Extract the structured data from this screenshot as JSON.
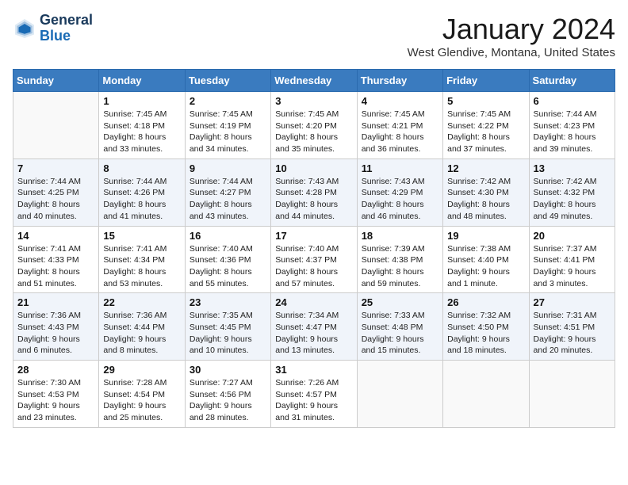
{
  "header": {
    "logo_line1": "General",
    "logo_line2": "Blue",
    "month_title": "January 2024",
    "location": "West Glendive, Montana, United States"
  },
  "days_of_week": [
    "Sunday",
    "Monday",
    "Tuesday",
    "Wednesday",
    "Thursday",
    "Friday",
    "Saturday"
  ],
  "weeks": [
    [
      {
        "day": "",
        "sunrise": "",
        "sunset": "",
        "daylight": ""
      },
      {
        "day": "1",
        "sunrise": "Sunrise: 7:45 AM",
        "sunset": "Sunset: 4:18 PM",
        "daylight": "Daylight: 8 hours and 33 minutes."
      },
      {
        "day": "2",
        "sunrise": "Sunrise: 7:45 AM",
        "sunset": "Sunset: 4:19 PM",
        "daylight": "Daylight: 8 hours and 34 minutes."
      },
      {
        "day": "3",
        "sunrise": "Sunrise: 7:45 AM",
        "sunset": "Sunset: 4:20 PM",
        "daylight": "Daylight: 8 hours and 35 minutes."
      },
      {
        "day": "4",
        "sunrise": "Sunrise: 7:45 AM",
        "sunset": "Sunset: 4:21 PM",
        "daylight": "Daylight: 8 hours and 36 minutes."
      },
      {
        "day": "5",
        "sunrise": "Sunrise: 7:45 AM",
        "sunset": "Sunset: 4:22 PM",
        "daylight": "Daylight: 8 hours and 37 minutes."
      },
      {
        "day": "6",
        "sunrise": "Sunrise: 7:44 AM",
        "sunset": "Sunset: 4:23 PM",
        "daylight": "Daylight: 8 hours and 39 minutes."
      }
    ],
    [
      {
        "day": "7",
        "sunrise": "Sunrise: 7:44 AM",
        "sunset": "Sunset: 4:25 PM",
        "daylight": "Daylight: 8 hours and 40 minutes."
      },
      {
        "day": "8",
        "sunrise": "Sunrise: 7:44 AM",
        "sunset": "Sunset: 4:26 PM",
        "daylight": "Daylight: 8 hours and 41 minutes."
      },
      {
        "day": "9",
        "sunrise": "Sunrise: 7:44 AM",
        "sunset": "Sunset: 4:27 PM",
        "daylight": "Daylight: 8 hours and 43 minutes."
      },
      {
        "day": "10",
        "sunrise": "Sunrise: 7:43 AM",
        "sunset": "Sunset: 4:28 PM",
        "daylight": "Daylight: 8 hours and 44 minutes."
      },
      {
        "day": "11",
        "sunrise": "Sunrise: 7:43 AM",
        "sunset": "Sunset: 4:29 PM",
        "daylight": "Daylight: 8 hours and 46 minutes."
      },
      {
        "day": "12",
        "sunrise": "Sunrise: 7:42 AM",
        "sunset": "Sunset: 4:30 PM",
        "daylight": "Daylight: 8 hours and 48 minutes."
      },
      {
        "day": "13",
        "sunrise": "Sunrise: 7:42 AM",
        "sunset": "Sunset: 4:32 PM",
        "daylight": "Daylight: 8 hours and 49 minutes."
      }
    ],
    [
      {
        "day": "14",
        "sunrise": "Sunrise: 7:41 AM",
        "sunset": "Sunset: 4:33 PM",
        "daylight": "Daylight: 8 hours and 51 minutes."
      },
      {
        "day": "15",
        "sunrise": "Sunrise: 7:41 AM",
        "sunset": "Sunset: 4:34 PM",
        "daylight": "Daylight: 8 hours and 53 minutes."
      },
      {
        "day": "16",
        "sunrise": "Sunrise: 7:40 AM",
        "sunset": "Sunset: 4:36 PM",
        "daylight": "Daylight: 8 hours and 55 minutes."
      },
      {
        "day": "17",
        "sunrise": "Sunrise: 7:40 AM",
        "sunset": "Sunset: 4:37 PM",
        "daylight": "Daylight: 8 hours and 57 minutes."
      },
      {
        "day": "18",
        "sunrise": "Sunrise: 7:39 AM",
        "sunset": "Sunset: 4:38 PM",
        "daylight": "Daylight: 8 hours and 59 minutes."
      },
      {
        "day": "19",
        "sunrise": "Sunrise: 7:38 AM",
        "sunset": "Sunset: 4:40 PM",
        "daylight": "Daylight: 9 hours and 1 minute."
      },
      {
        "day": "20",
        "sunrise": "Sunrise: 7:37 AM",
        "sunset": "Sunset: 4:41 PM",
        "daylight": "Daylight: 9 hours and 3 minutes."
      }
    ],
    [
      {
        "day": "21",
        "sunrise": "Sunrise: 7:36 AM",
        "sunset": "Sunset: 4:43 PM",
        "daylight": "Daylight: 9 hours and 6 minutes."
      },
      {
        "day": "22",
        "sunrise": "Sunrise: 7:36 AM",
        "sunset": "Sunset: 4:44 PM",
        "daylight": "Daylight: 9 hours and 8 minutes."
      },
      {
        "day": "23",
        "sunrise": "Sunrise: 7:35 AM",
        "sunset": "Sunset: 4:45 PM",
        "daylight": "Daylight: 9 hours and 10 minutes."
      },
      {
        "day": "24",
        "sunrise": "Sunrise: 7:34 AM",
        "sunset": "Sunset: 4:47 PM",
        "daylight": "Daylight: 9 hours and 13 minutes."
      },
      {
        "day": "25",
        "sunrise": "Sunrise: 7:33 AM",
        "sunset": "Sunset: 4:48 PM",
        "daylight": "Daylight: 9 hours and 15 minutes."
      },
      {
        "day": "26",
        "sunrise": "Sunrise: 7:32 AM",
        "sunset": "Sunset: 4:50 PM",
        "daylight": "Daylight: 9 hours and 18 minutes."
      },
      {
        "day": "27",
        "sunrise": "Sunrise: 7:31 AM",
        "sunset": "Sunset: 4:51 PM",
        "daylight": "Daylight: 9 hours and 20 minutes."
      }
    ],
    [
      {
        "day": "28",
        "sunrise": "Sunrise: 7:30 AM",
        "sunset": "Sunset: 4:53 PM",
        "daylight": "Daylight: 9 hours and 23 minutes."
      },
      {
        "day": "29",
        "sunrise": "Sunrise: 7:28 AM",
        "sunset": "Sunset: 4:54 PM",
        "daylight": "Daylight: 9 hours and 25 minutes."
      },
      {
        "day": "30",
        "sunrise": "Sunrise: 7:27 AM",
        "sunset": "Sunset: 4:56 PM",
        "daylight": "Daylight: 9 hours and 28 minutes."
      },
      {
        "day": "31",
        "sunrise": "Sunrise: 7:26 AM",
        "sunset": "Sunset: 4:57 PM",
        "daylight": "Daylight: 9 hours and 31 minutes."
      },
      {
        "day": "",
        "sunrise": "",
        "sunset": "",
        "daylight": ""
      },
      {
        "day": "",
        "sunrise": "",
        "sunset": "",
        "daylight": ""
      },
      {
        "day": "",
        "sunrise": "",
        "sunset": "",
        "daylight": ""
      }
    ]
  ]
}
